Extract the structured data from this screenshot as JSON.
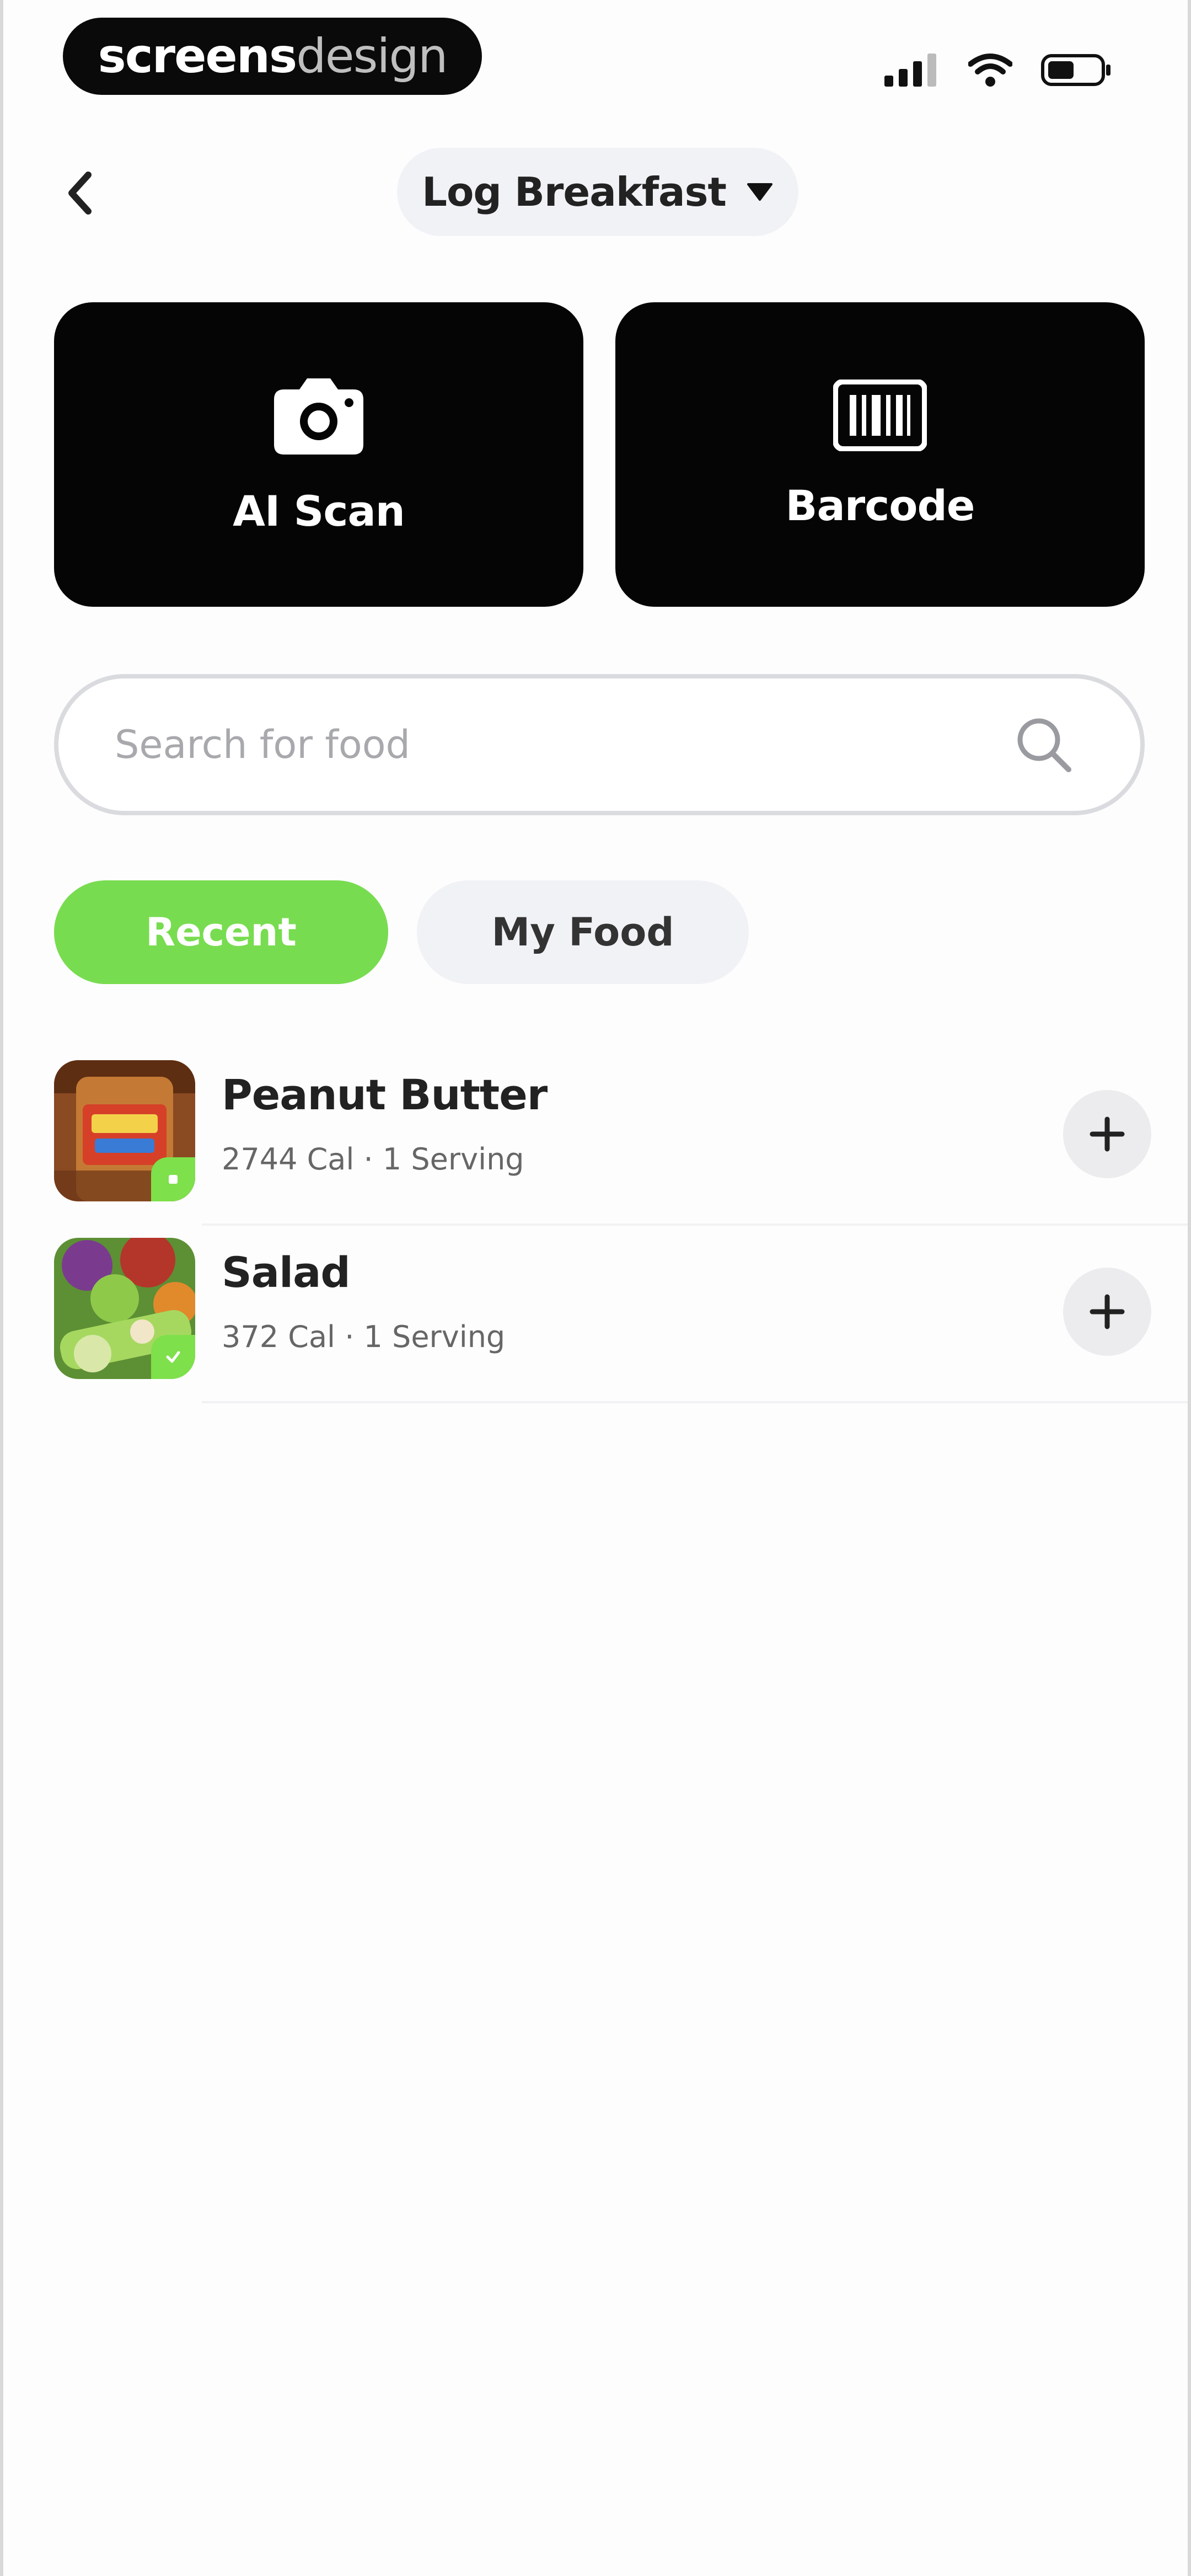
{
  "status_bar": {
    "brand_bold": "screens",
    "brand_light": "design"
  },
  "header": {
    "meal_label": "Log Breakfast"
  },
  "actions": [
    {
      "label": "AI Scan",
      "icon": "camera-icon"
    },
    {
      "label": "Barcode",
      "icon": "barcode-icon"
    }
  ],
  "search": {
    "placeholder": "Search for food",
    "value": ""
  },
  "tabs": [
    {
      "label": "Recent",
      "active": true
    },
    {
      "label": "My Food",
      "active": false
    }
  ],
  "foods": [
    {
      "name": "Peanut Butter",
      "meta": "2744 Cal · 1 Serving"
    },
    {
      "name": "Salad",
      "meta": "372 Cal · 1 Serving"
    }
  ],
  "colors": {
    "accent_green": "#78dc50",
    "card_black": "#050505",
    "chip_gray": "#f1f2f6"
  }
}
